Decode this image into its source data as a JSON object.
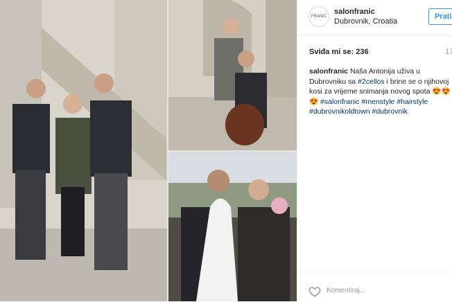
{
  "post": {
    "username": "salonfranic",
    "location": "Dubrovnik, Croatia",
    "follow_label": "Prati",
    "likes": "Sviđa mi se: 236",
    "time": "17",
    "caption": {
      "username": "salonfranic",
      "text1": " Naša Antonija uživa u Dubrovniku sa ",
      "tag1": "#2cellos",
      "text2": " i brine se o njihovoj kosi za vrijeme snimanja novog spota 😍😍😍 ",
      "tag2": "#salonfranic",
      "tag3": "#menstyle",
      "tag4": "#hairstyle",
      "tag5": "#dubrovnikoldtown",
      "tag6": "#dubrovnik"
    },
    "comment_placeholder": "Komentiraj..."
  },
  "avatar_text": "FRANIC"
}
